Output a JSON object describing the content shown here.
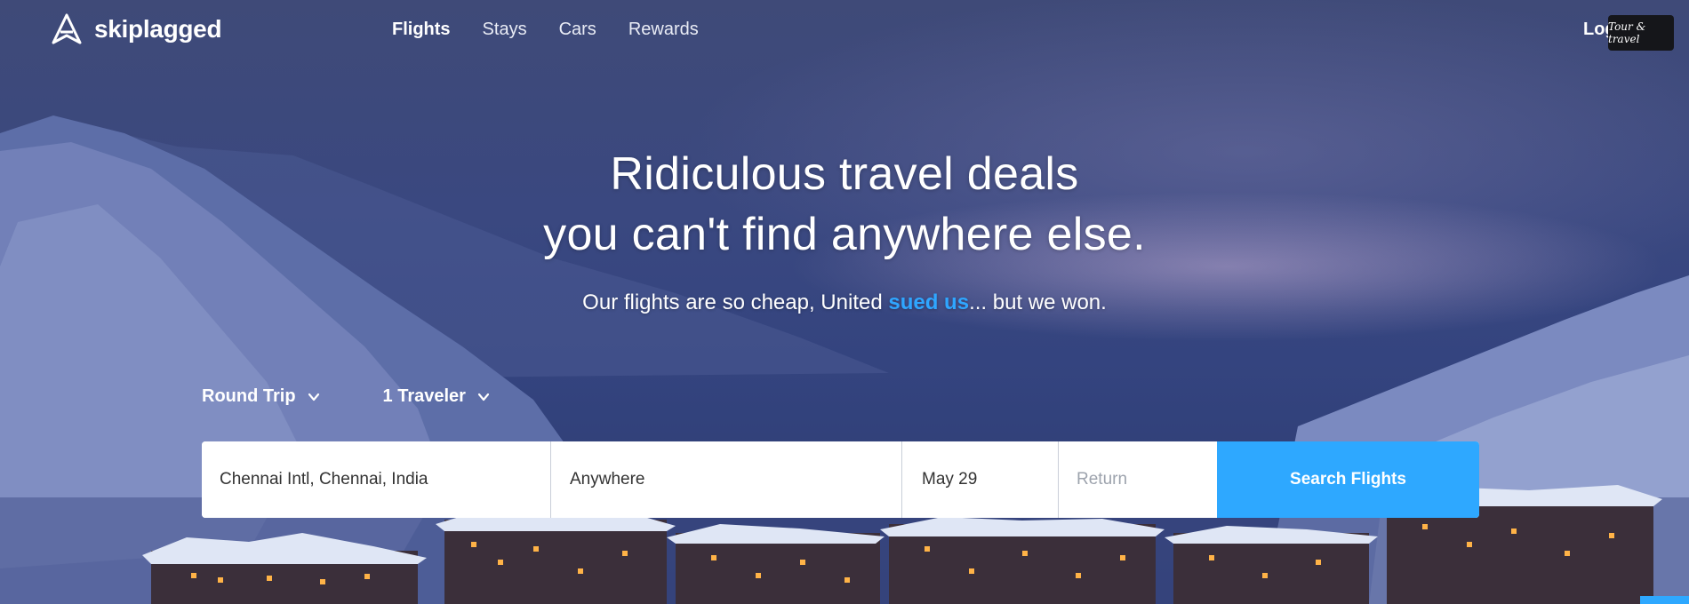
{
  "brand": {
    "name": "skiplagged",
    "logo_icon": "skiplagged-logo-icon"
  },
  "nav": {
    "items": [
      "Flights",
      "Stays",
      "Cars",
      "Rewards"
    ],
    "active": "Flights",
    "login_label": "Log"
  },
  "widget": {
    "label": "Tour & travel"
  },
  "hero": {
    "headline_line1": "Ridiculous travel deals",
    "headline_line2": "you can't find anywhere else.",
    "sub_before": "Our flights are so cheap, United ",
    "sub_link": "sued us",
    "sub_after": "... but we won."
  },
  "search": {
    "trip_type": "Round Trip",
    "travelers": "1 Traveler",
    "origin": "Chennai Intl, Chennai, India",
    "destination": "Anywhere",
    "depart_date": "May 29",
    "return_placeholder": "Return",
    "button_label": "Search Flights"
  },
  "colors": {
    "accent": "#2ea8ff",
    "link": "#2fa6ff",
    "sky": "#3a4880"
  },
  "icons": {
    "dropdown": "chevron-down-icon"
  }
}
